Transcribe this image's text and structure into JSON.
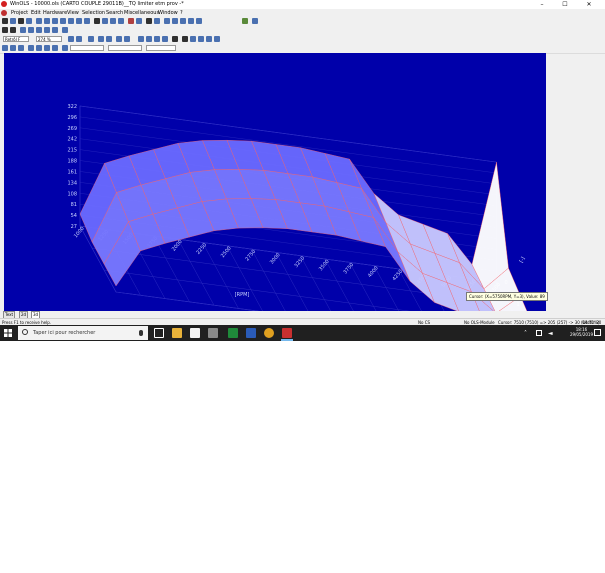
{
  "window": {
    "title": "WinOLS - 10000.ols (CARTO COUPLE 29011B)__TQ limiter etm prov -*",
    "controls": [
      "–",
      "☐",
      "✕"
    ]
  },
  "menu": [
    "Project",
    "Edit",
    "Hardware",
    "View",
    "Selection",
    "Search",
    "Miscellaneous",
    "Window",
    "?"
  ],
  "toolbar3": {
    "field1": "Retrôl F",
    "field2": "274 %"
  },
  "chart_data": {
    "type": "surface-3d",
    "x_label": "[RPM]",
    "x_ticks": [
      "1000",
      "1250",
      "1500",
      "1750",
      "2000",
      "2250",
      "2500",
      "2750",
      "3000",
      "3250",
      "3500",
      "3750",
      "4000",
      "4250",
      "4500",
      "5000",
      "5250",
      "5500"
    ],
    "y_label": "[-]",
    "y_ticks": [
      "0",
      "1",
      "2",
      "3"
    ],
    "z_ticks": [
      "322",
      "296",
      "269",
      "242",
      "215",
      "188",
      "161",
      "134",
      "108",
      "81",
      "54",
      "27"
    ],
    "surface_color": "#6a6aff",
    "grid_color": "#ff6666",
    "background": "#0000aa"
  },
  "tabs": [
    "Text",
    "2d",
    "3d"
  ],
  "status": {
    "help": "Press F1 to receive help.",
    "cs": "No CS",
    "module": "No OLS-Module",
    "cursor": "Cursor: 7510 (7510) => 205 (257) -> 30 (14.72%)",
    "width": "Width: 20"
  },
  "tooltip": "Cursor: (X=5750RPM, Y=3), Value: 89",
  "taskbar": {
    "search_placeholder": "Taper ici pour rechercher",
    "time": "18:16",
    "date": "29/05/2019"
  }
}
